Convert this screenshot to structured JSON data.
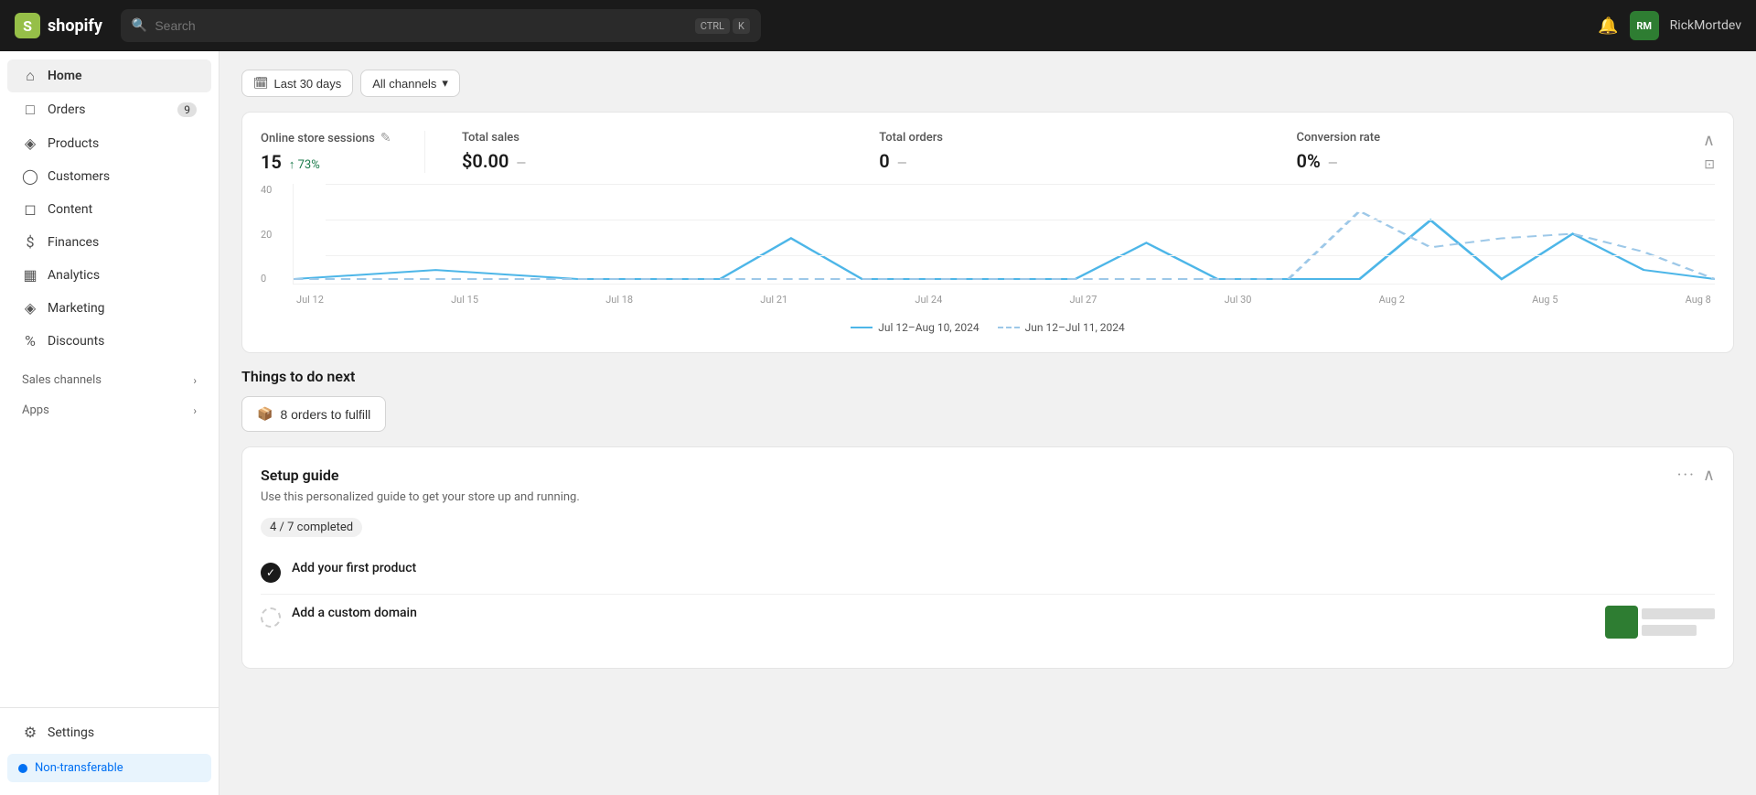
{
  "topnav": {
    "logo_text": "shopify",
    "search_placeholder": "Search",
    "search_shortcut_1": "CTRL",
    "search_shortcut_2": "K",
    "username": "RickMortdev",
    "avatar_initials": "RM"
  },
  "sidebar": {
    "items": [
      {
        "id": "home",
        "label": "Home",
        "icon": "⌂",
        "active": true
      },
      {
        "id": "orders",
        "label": "Orders",
        "icon": "📦",
        "badge": "9"
      },
      {
        "id": "products",
        "label": "Products",
        "icon": "🏷️"
      },
      {
        "id": "customers",
        "label": "Customers",
        "icon": "👤"
      },
      {
        "id": "content",
        "label": "Content",
        "icon": "📄"
      },
      {
        "id": "finances",
        "label": "Finances",
        "icon": "💰"
      },
      {
        "id": "analytics",
        "label": "Analytics",
        "icon": "📊"
      },
      {
        "id": "marketing",
        "label": "Marketing",
        "icon": "📣"
      },
      {
        "id": "discounts",
        "label": "Discounts",
        "icon": "🏷"
      }
    ],
    "sales_channels_label": "Sales channels",
    "apps_label": "Apps",
    "settings_label": "Settings",
    "non_transferable_label": "Non-transferable"
  },
  "filters": {
    "date_range": "Last 30 days",
    "channels": "All channels"
  },
  "metrics": {
    "sessions_title": "Online store sessions",
    "sessions_value": "15",
    "sessions_change": "↑ 73%",
    "total_sales_title": "Total sales",
    "total_sales_value": "$0.00",
    "total_orders_title": "Total orders",
    "total_orders_value": "0",
    "conversion_title": "Conversion rate",
    "conversion_value": "0%"
  },
  "chart": {
    "y_labels": [
      "40",
      "20",
      "0"
    ],
    "x_labels": [
      "Jul 12",
      "Jul 15",
      "Jul 18",
      "Jul 21",
      "Jul 24",
      "Jul 27",
      "Jul 30",
      "Aug 2",
      "Aug 5",
      "Aug 8"
    ],
    "legend_current": "Jul 12–Aug 10, 2024",
    "legend_previous": "Jun 12–Jul 11, 2024"
  },
  "things_to_do": {
    "title": "Things to do next",
    "fulfill_label": "8 orders to fulfill"
  },
  "setup_guide": {
    "title": "Setup guide",
    "description": "Use this personalized guide to get your store up and running.",
    "progress_label": "4 / 7 completed",
    "items": [
      {
        "id": "first-product",
        "label": "Add your first product",
        "completed": true
      },
      {
        "id": "custom-domain",
        "label": "Add a custom domain",
        "completed": false
      }
    ]
  }
}
